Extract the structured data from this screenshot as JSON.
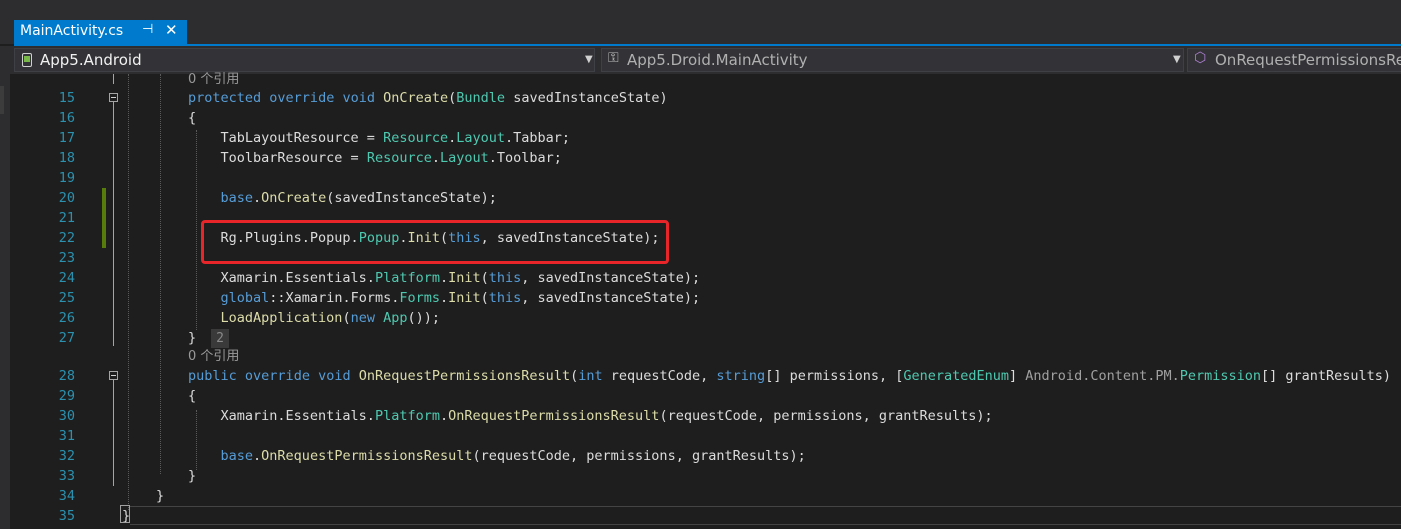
{
  "tab": {
    "title": "MainActivity.cs",
    "pin_icon": "pin-icon",
    "close_icon": "close-icon"
  },
  "nav": {
    "project": "App5.Android",
    "class": "App5.Droid.MainActivity",
    "member": "OnRequestPermissionsResult"
  },
  "refs_label": "0 个引用",
  "badge": "2",
  "lines": [
    {
      "n": "15"
    },
    {
      "n": "16"
    },
    {
      "n": "17"
    },
    {
      "n": "18"
    },
    {
      "n": "19"
    },
    {
      "n": "20"
    },
    {
      "n": "21"
    },
    {
      "n": "22"
    },
    {
      "n": "23"
    },
    {
      "n": "24"
    },
    {
      "n": "25"
    },
    {
      "n": "26"
    },
    {
      "n": "27"
    },
    {
      "n": "28"
    },
    {
      "n": "29"
    },
    {
      "n": "30"
    },
    {
      "n": "31"
    },
    {
      "n": "32"
    },
    {
      "n": "33"
    },
    {
      "n": "34"
    },
    {
      "n": "35"
    }
  ],
  "colors": {
    "accent": "#007acc",
    "highlight_box": "#e8262a",
    "change_bar": "#587c0c"
  }
}
